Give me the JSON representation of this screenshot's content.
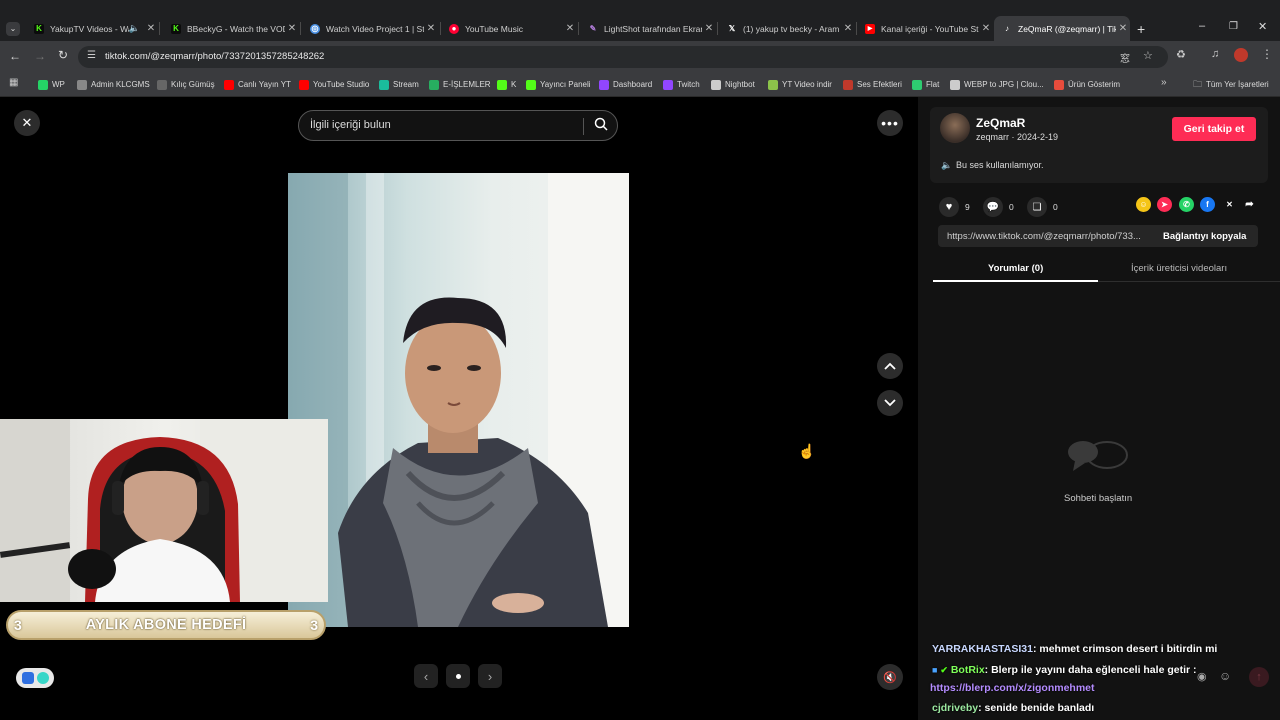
{
  "tabs": [
    {
      "title": "YakupTV Videos - Wa",
      "icon": "kick-icon",
      "color": "#53fc18"
    },
    {
      "title": "BBeckyG - Watch the VOD",
      "icon": "kick-icon",
      "color": "#53fc18"
    },
    {
      "title": "Watch Video Project 1 | St",
      "icon": "video-project-icon",
      "color": "#4a90e2"
    },
    {
      "title": "YouTube Music",
      "icon": "youtube-music-icon",
      "color": "#ff0033"
    },
    {
      "title": "LightShot tarafından Ekran",
      "icon": "lightshot-icon",
      "color": "#9b59b6"
    },
    {
      "title": "(1) yakup tv becky - Aram",
      "icon": "x-icon",
      "color": "#ffffff"
    },
    {
      "title": "Kanal içeriği - YouTube St",
      "icon": "youtube-studio-icon",
      "color": "#ff0000"
    },
    {
      "title": "ZeQmaR (@zeqmarr) | Tik",
      "icon": "tiktok-icon",
      "color": "#ffffff"
    }
  ],
  "address": {
    "url": "tiktok.com/@zeqmarr/photo/7337201357285248262"
  },
  "bookmarks": [
    {
      "label": "WP",
      "icon": "whatsapp-icon",
      "color": "#25d366"
    },
    {
      "label": "Admin KLCGMS",
      "icon": "admin-icon",
      "color": "#888888"
    },
    {
      "label": "Kılıç Gümüş",
      "icon": "kilic-icon",
      "color": "#666666"
    },
    {
      "label": "Canlı Yayın YT",
      "icon": "youtube-icon",
      "color": "#ff0000"
    },
    {
      "label": "YouTube Studio",
      "icon": "youtube-icon",
      "color": "#ff0000"
    },
    {
      "label": "Stream",
      "icon": "stream-icon",
      "color": "#1abc9c"
    },
    {
      "label": "E-İŞLEMLER",
      "icon": "e-islemler-icon",
      "color": "#27ae60"
    },
    {
      "label": "K",
      "icon": "kick-icon",
      "color": "#53fc18"
    },
    {
      "label": "Yayıncı Paneli",
      "icon": "kick-icon",
      "color": "#53fc18"
    },
    {
      "label": "Dashboard",
      "icon": "twitch-icon",
      "color": "#9146ff"
    },
    {
      "label": "Twitch",
      "icon": "twitch-icon",
      "color": "#9146ff"
    },
    {
      "label": "Nightbot",
      "icon": "nightbot-icon",
      "color": "#cccccc"
    },
    {
      "label": "YT Video indir",
      "icon": "download-icon",
      "color": "#8bc34a"
    },
    {
      "label": "Ses Efektleri",
      "icon": "ses-icon",
      "color": "#c0392b"
    },
    {
      "label": "Flat",
      "icon": "flat-icon",
      "color": "#2ecc71"
    },
    {
      "label": "WEBP to JPG | Clou...",
      "icon": "cloud-icon",
      "color": "#cccccc"
    },
    {
      "label": "Ürün Gösterim",
      "icon": "urun-icon",
      "color": "#e74c3c"
    }
  ],
  "bookmarks_all": "Tüm Yer İşaretleri",
  "viewer": {
    "search_placeholder": "İlgili içeriği bulun",
    "goal_left": "3",
    "goal_label": "AYLIK ABONE HEDEFİ",
    "goal_right": "3"
  },
  "profile": {
    "name": "ZeQmaR",
    "handle_date": "zeqmarr · 2024-2-19",
    "follow_label": "Geri takip et",
    "sound_text": "Bu ses kullanılamıyor."
  },
  "stats": {
    "likes": "9",
    "comments": "0",
    "saves": "0"
  },
  "link": {
    "url": "https://www.tiktok.com/@zeqmarr/photo/733...",
    "copy_label": "Bağlantıyı kopyala"
  },
  "side_tabs": {
    "comments": "Yorumlar (0)",
    "creator_videos": "İçerik üreticisi videoları"
  },
  "empty_state": "Sohbeti başlatın",
  "chat": [
    {
      "user": "YARRAKHASTASI31",
      "text": ": mehmet crimson desert i bitirdin mi",
      "color": "#c8d8ff"
    },
    {
      "user": "BotRix",
      "text": ": Blerp ile yayını daha eğlenceli hale getir :",
      "color": "#7fff5a"
    },
    {
      "user": "",
      "text": "https://blerp.com/x/zigonmehmet",
      "color": "#b48cff"
    },
    {
      "user": "cjdriveby",
      "text": ": senide benide banladı",
      "color": "#9be8a0"
    }
  ],
  "colors": {
    "tiktok_red": "#fe2c55",
    "panel_bg": "#121212",
    "accent_underline": "#ffffff"
  }
}
